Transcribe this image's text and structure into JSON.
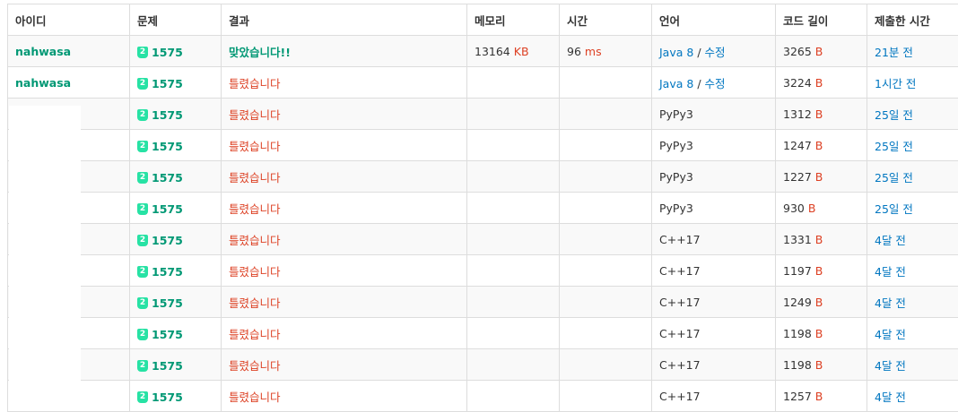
{
  "headers": {
    "user": "아이디",
    "problem": "문제",
    "result": "결과",
    "memory": "메모리",
    "time": "시간",
    "language": "언어",
    "code_length": "코드 길이",
    "submitted": "제출한 시간"
  },
  "rows": [
    {
      "user": "nahwasa",
      "tier": "2",
      "problem": "1575",
      "result": "맞았습니다!!",
      "result_type": "ac",
      "memory": "13164",
      "memory_unit": "KB",
      "time": "96",
      "time_unit": "ms",
      "language": "Java 8",
      "edit": "수정",
      "length": "3265",
      "length_unit": "B",
      "submitted": "21분 전"
    },
    {
      "user": "nahwasa",
      "tier": "2",
      "problem": "1575",
      "result": "틀렸습니다",
      "result_type": "wa",
      "memory": "",
      "memory_unit": "",
      "time": "",
      "time_unit": "",
      "language": "Java 8",
      "edit": "수정",
      "length": "3224",
      "length_unit": "B",
      "submitted": "1시간 전"
    },
    {
      "user": "",
      "tier": "2",
      "problem": "1575",
      "result": "틀렸습니다",
      "result_type": "wa",
      "memory": "",
      "memory_unit": "",
      "time": "",
      "time_unit": "",
      "language": "PyPy3",
      "edit": "",
      "length": "1312",
      "length_unit": "B",
      "submitted": "25일 전"
    },
    {
      "user": "",
      "tier": "2",
      "problem": "1575",
      "result": "틀렸습니다",
      "result_type": "wa",
      "memory": "",
      "memory_unit": "",
      "time": "",
      "time_unit": "",
      "language": "PyPy3",
      "edit": "",
      "length": "1247",
      "length_unit": "B",
      "submitted": "25일 전"
    },
    {
      "user": "",
      "tier": "2",
      "problem": "1575",
      "result": "틀렸습니다",
      "result_type": "wa",
      "memory": "",
      "memory_unit": "",
      "time": "",
      "time_unit": "",
      "language": "PyPy3",
      "edit": "",
      "length": "1227",
      "length_unit": "B",
      "submitted": "25일 전"
    },
    {
      "user": "",
      "tier": "2",
      "problem": "1575",
      "result": "틀렸습니다",
      "result_type": "wa",
      "memory": "",
      "memory_unit": "",
      "time": "",
      "time_unit": "",
      "language": "PyPy3",
      "edit": "",
      "length": "930",
      "length_unit": "B",
      "submitted": "25일 전"
    },
    {
      "user": "",
      "tier": "2",
      "problem": "1575",
      "result": "틀렸습니다",
      "result_type": "wa",
      "memory": "",
      "memory_unit": "",
      "time": "",
      "time_unit": "",
      "language": "C++17",
      "edit": "",
      "length": "1331",
      "length_unit": "B",
      "submitted": "4달 전"
    },
    {
      "user": "",
      "tier": "2",
      "problem": "1575",
      "result": "틀렸습니다",
      "result_type": "wa",
      "memory": "",
      "memory_unit": "",
      "time": "",
      "time_unit": "",
      "language": "C++17",
      "edit": "",
      "length": "1197",
      "length_unit": "B",
      "submitted": "4달 전"
    },
    {
      "user": "",
      "tier": "2",
      "problem": "1575",
      "result": "틀렸습니다",
      "result_type": "wa",
      "memory": "",
      "memory_unit": "",
      "time": "",
      "time_unit": "",
      "language": "C++17",
      "edit": "",
      "length": "1249",
      "length_unit": "B",
      "submitted": "4달 전"
    },
    {
      "user": "",
      "tier": "2",
      "problem": "1575",
      "result": "틀렸습니다",
      "result_type": "wa",
      "memory": "",
      "memory_unit": "",
      "time": "",
      "time_unit": "",
      "language": "C++17",
      "edit": "",
      "length": "1198",
      "length_unit": "B",
      "submitted": "4달 전"
    },
    {
      "user": "",
      "tier": "2",
      "problem": "1575",
      "result": "틀렸습니다",
      "result_type": "wa",
      "memory": "",
      "memory_unit": "",
      "time": "",
      "time_unit": "",
      "language": "C++17",
      "edit": "",
      "length": "1198",
      "length_unit": "B",
      "submitted": "4달 전"
    },
    {
      "user": "",
      "tier": "2",
      "problem": "1575",
      "result": "틀렸습니다",
      "result_type": "wa",
      "memory": "",
      "memory_unit": "",
      "time": "",
      "time_unit": "",
      "language": "C++17",
      "edit": "",
      "length": "1257",
      "length_unit": "B",
      "submitted": "4달 전"
    }
  ],
  "colors": {
    "accent_green": "#009874",
    "wrong_red": "#dd4124",
    "link_blue": "#0076c0",
    "tier_badge": "#27e2a4"
  },
  "icons": {
    "tier": "silver-tier-badge-icon"
  }
}
